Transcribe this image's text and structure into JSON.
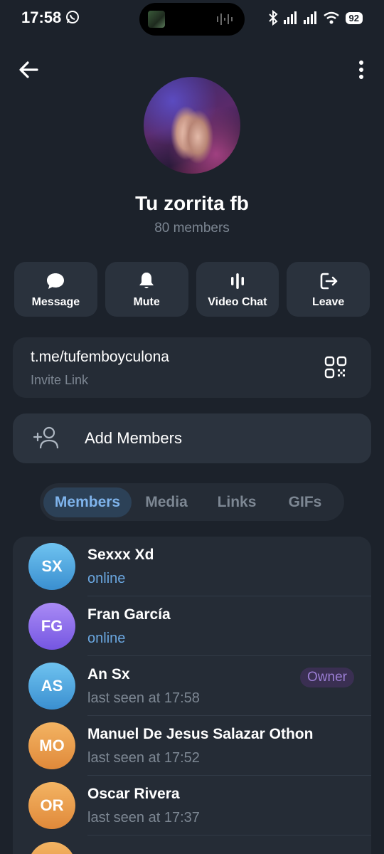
{
  "status_bar": {
    "time": "17:58",
    "battery": "92"
  },
  "group": {
    "title": "Tu zorrita fb",
    "member_count": "80 members"
  },
  "actions": [
    {
      "label": "Message",
      "icon": "message-bubble-icon"
    },
    {
      "label": "Mute",
      "icon": "bell-icon"
    },
    {
      "label": "Video Chat",
      "icon": "voice-chat-icon"
    },
    {
      "label": "Leave",
      "icon": "leave-icon"
    }
  ],
  "invite": {
    "link": "t.me/tufemboyculona",
    "label": "Invite Link"
  },
  "add_members": {
    "label": "Add Members"
  },
  "tabs": [
    {
      "label": "Members",
      "active": true
    },
    {
      "label": "Media",
      "active": false
    },
    {
      "label": "Links",
      "active": false
    },
    {
      "label": "GIFs",
      "active": false
    }
  ],
  "members": [
    {
      "initials": "SX",
      "name": "Sexxx Xd",
      "status": "online",
      "color": "#4f9fe0"
    },
    {
      "initials": "FG",
      "name": "Fran García",
      "status": "online",
      "color": "#8b6cf0"
    },
    {
      "initials": "AS",
      "name": "An Sx",
      "status": "last seen at 17:58",
      "badge": "Owner",
      "color": "#4f9fe0"
    },
    {
      "initials": "MO",
      "name": "Manuel De Jesus Salazar Othon",
      "status": "last seen at 17:52",
      "color": "#eb9a4a"
    },
    {
      "initials": "OR",
      "name": "Oscar Rivera",
      "status": "last seen at 17:37",
      "color": "#eb9a4a"
    }
  ],
  "colors": {
    "background": "#1c222b",
    "card": "#252c36",
    "accent": "#7fb4ec",
    "online": "#6aa6df",
    "muted": "#7d8793"
  }
}
